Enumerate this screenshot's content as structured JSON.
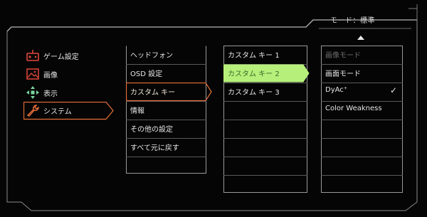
{
  "header": {
    "mode_text": "モード：標準"
  },
  "sidebar": {
    "items": [
      {
        "label": "ゲーム設定",
        "icon": "gamepad-icon"
      },
      {
        "label": "画像",
        "icon": "picture-icon"
      },
      {
        "label": "表示",
        "icon": "display-arrows-icon"
      },
      {
        "label": "システム",
        "icon": "wrench-icon",
        "selected": true
      }
    ]
  },
  "system_menu": {
    "items": [
      {
        "label": "ヘッドフォン"
      },
      {
        "label": "OSD 設定"
      },
      {
        "label": "カスタム キー",
        "selected": true
      },
      {
        "label": "情報"
      },
      {
        "label": "その他の設定"
      },
      {
        "label": "すべて元に戻す"
      }
    ]
  },
  "custom_key_menu": {
    "items": [
      {
        "label": "カスタム キー 1"
      },
      {
        "label": "カスタム キー 2",
        "selected": true
      },
      {
        "label": "カスタム キー 3"
      }
    ]
  },
  "options_menu": {
    "items": [
      {
        "label": "画像モード",
        "disabled": true
      },
      {
        "label": "画面モード"
      },
      {
        "label": "DyAc⁺",
        "checked": true
      },
      {
        "label": "Color Weakness"
      }
    ],
    "check_symbol": "✓"
  },
  "colors": {
    "accent_orange": "#e8703a",
    "accent_green": "#b6f07a",
    "icon_red": "#e0483c",
    "icon_green": "#7ad8a0"
  }
}
